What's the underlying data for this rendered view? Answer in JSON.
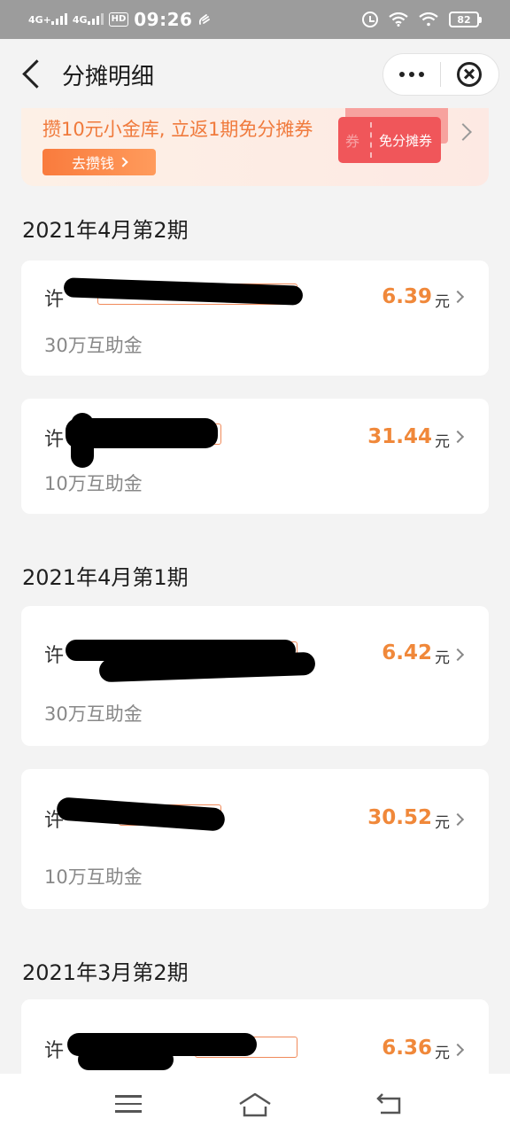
{
  "status_bar": {
    "net1": "4G+",
    "net2": "4G",
    "hd": "HD",
    "time": "09:26",
    "battery": "82"
  },
  "nav": {
    "title": "分摊明细"
  },
  "banner": {
    "text": "攒10元小金库, 立返1期免分摊券",
    "button_label": "去攒钱",
    "coupon_label": "免分摊券",
    "coupon_stamp": "券"
  },
  "periods": [
    {
      "title": "2021年4月第2期",
      "records": [
        {
          "name_visible": "许",
          "amount": "6.39",
          "unit": "元",
          "plan": "30万互助金"
        },
        {
          "name_visible": "许",
          "amount": "31.44",
          "unit": "元",
          "plan": "10万互助金"
        }
      ]
    },
    {
      "title": "2021年4月第1期",
      "records": [
        {
          "name_visible": "许",
          "amount": "6.42",
          "unit": "元",
          "plan": "30万互助金"
        },
        {
          "name_visible": "许",
          "amount": "30.52",
          "unit": "元",
          "plan": "10万互助金"
        }
      ]
    },
    {
      "title": "2021年3月第2期",
      "records": [
        {
          "name_visible": "许",
          "amount": "6.36",
          "unit": "元",
          "plan": ""
        }
      ]
    }
  ],
  "colors": {
    "accent": "#f0883a",
    "coupon": "#f0565a"
  }
}
